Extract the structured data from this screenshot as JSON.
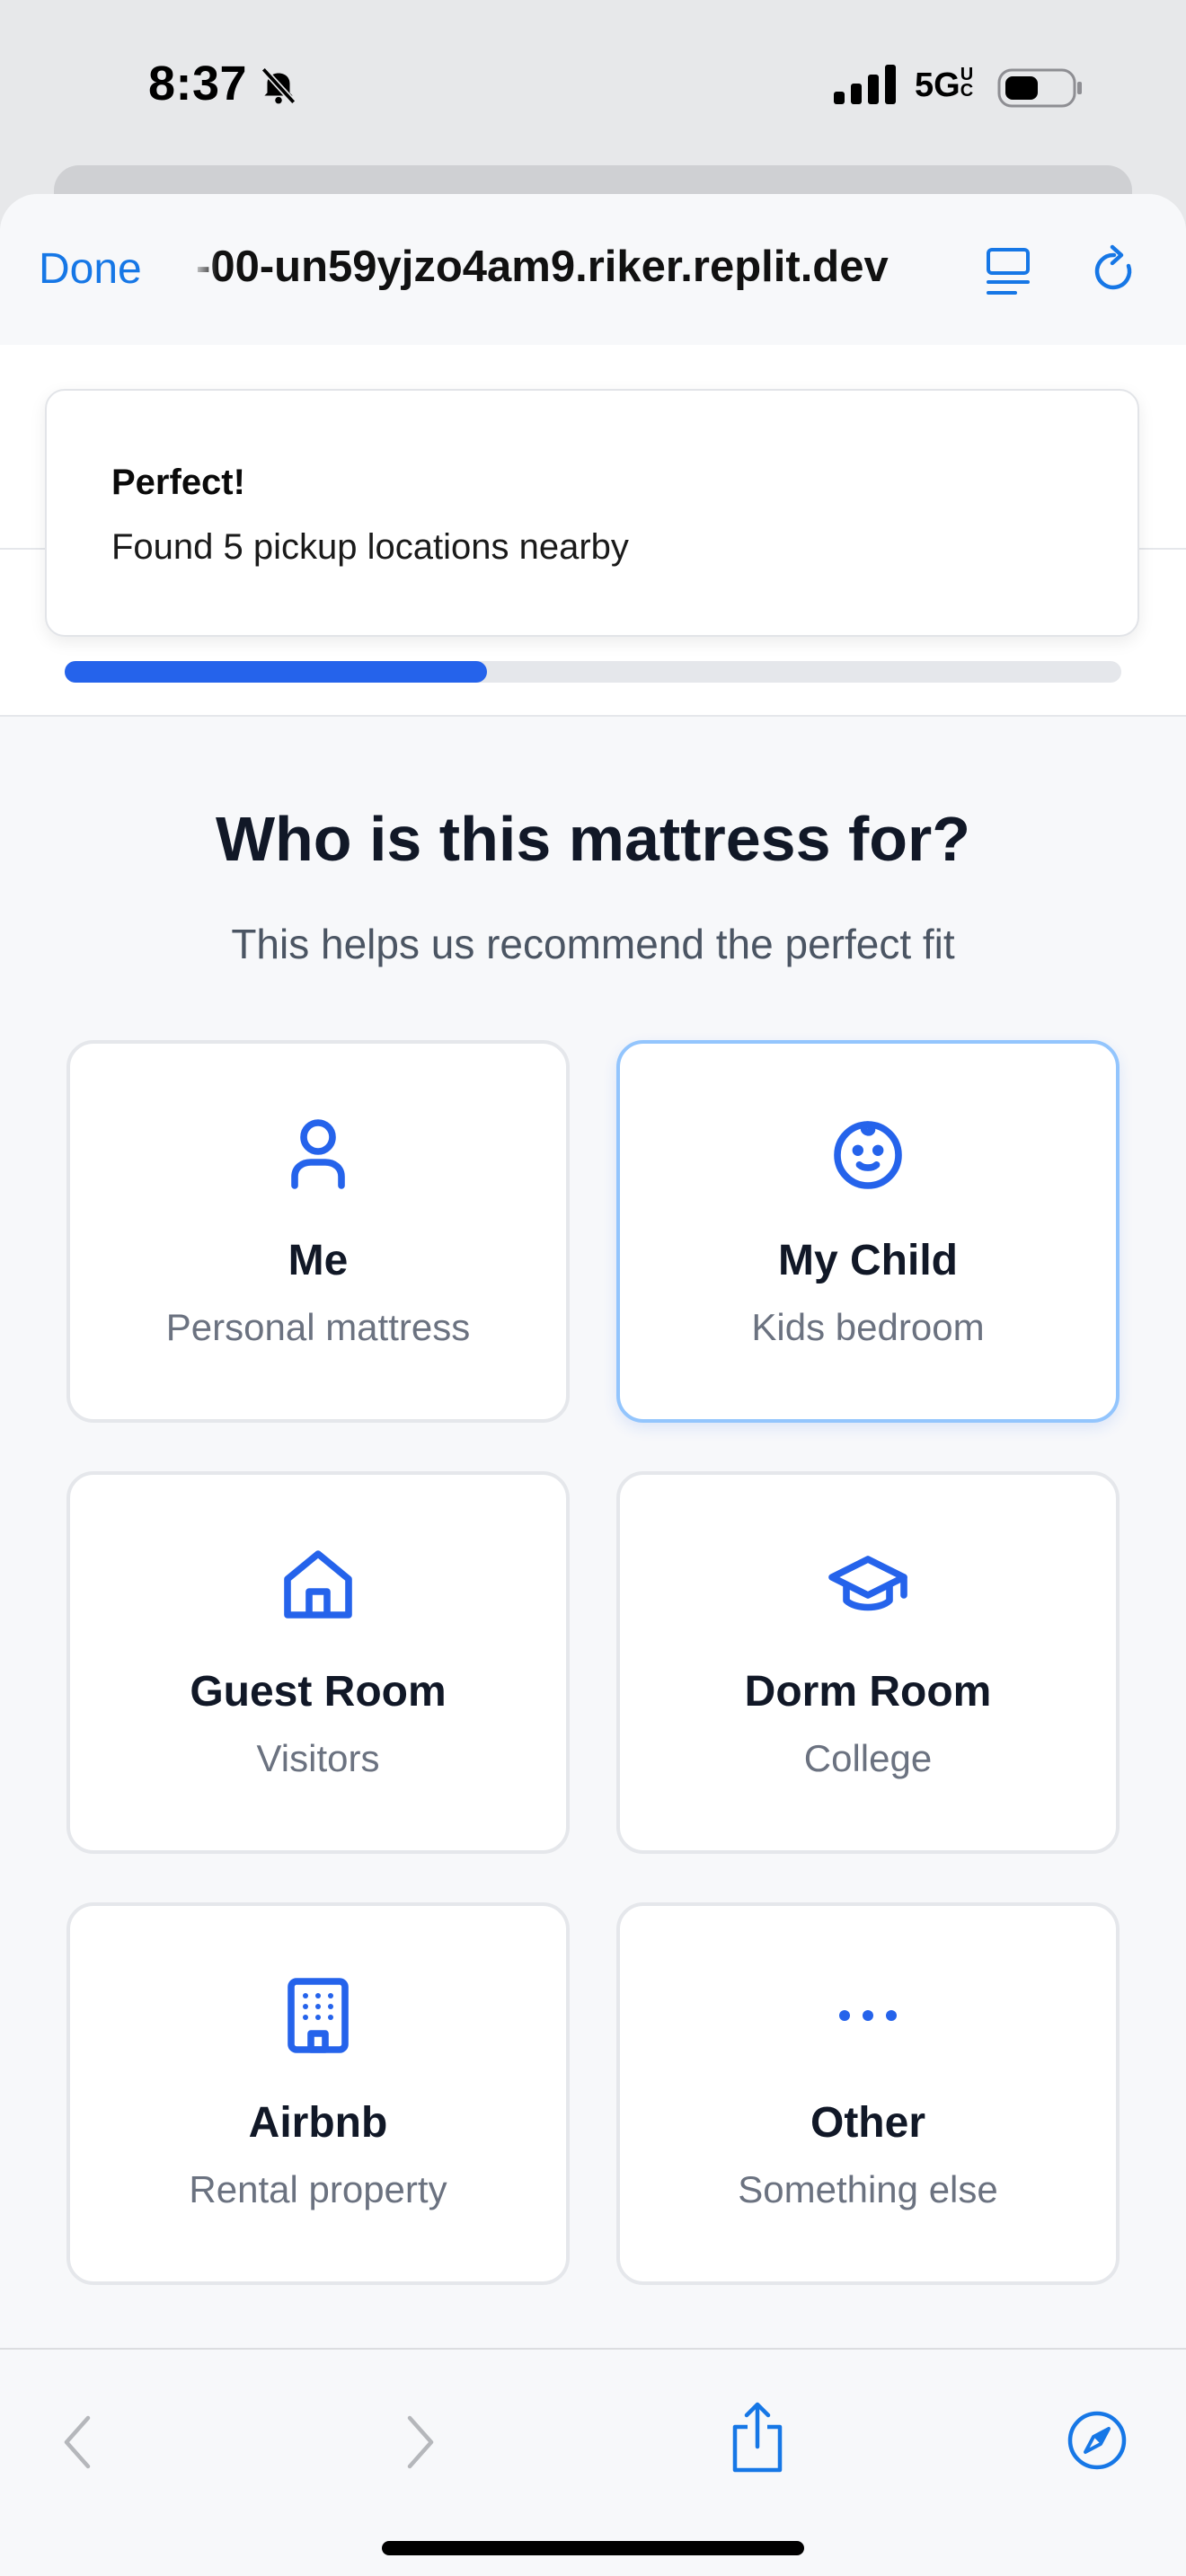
{
  "status_bar": {
    "time": "8:37",
    "network": "5G",
    "network_sub": "UC"
  },
  "browser": {
    "done_label": "Done",
    "url": "-00-un59yjzo4am9.riker.replit.dev"
  },
  "toast": {
    "title": "Perfect!",
    "message": "Found 5 pickup locations nearby"
  },
  "progress": {
    "fraction": 0.4
  },
  "question": {
    "title": "Who is this mattress for?",
    "subtitle": "This helps us recommend the perfect fit"
  },
  "options": [
    {
      "label": "Me",
      "description": "Personal mattress",
      "icon": "user-icon"
    },
    {
      "label": "My Child",
      "description": "Kids bedroom",
      "icon": "baby-icon",
      "selected": true
    },
    {
      "label": "Guest Room",
      "description": "Visitors",
      "icon": "home-icon"
    },
    {
      "label": "Dorm Room",
      "description": "College",
      "icon": "graduation-cap-icon"
    },
    {
      "label": "Airbnb",
      "description": "Rental property",
      "icon": "building-icon"
    },
    {
      "label": "Other",
      "description": "Something else",
      "icon": "more-horizontal-icon"
    }
  ],
  "colors": {
    "accent": "#2563eb",
    "ios_blue": "#1677e6",
    "selected_border": "#93c5fd"
  }
}
